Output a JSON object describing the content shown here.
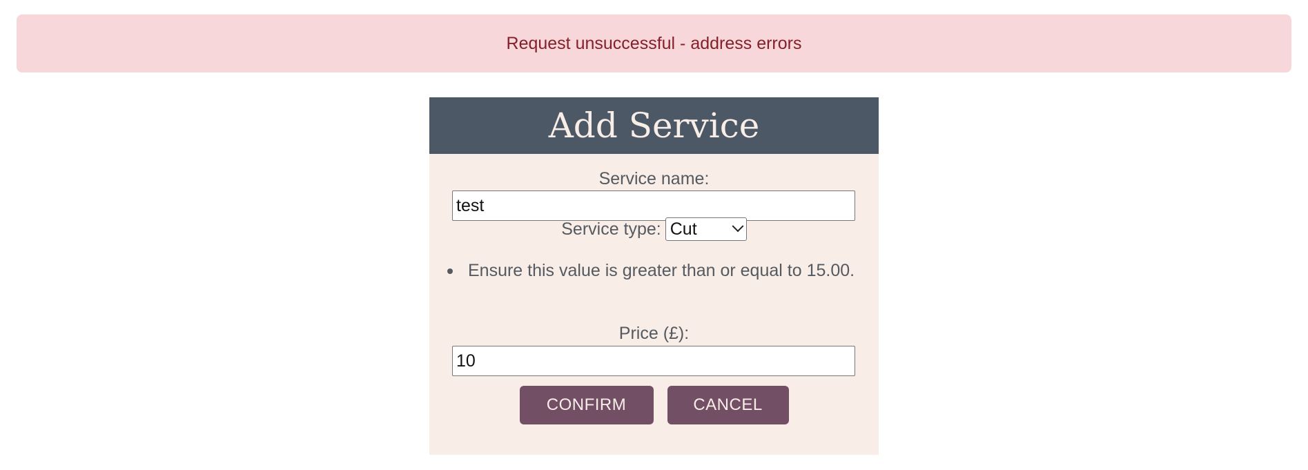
{
  "alert": {
    "message": "Request unsuccessful - address errors"
  },
  "form": {
    "title": "Add Service",
    "service_name_label": "Service name:",
    "service_name_value": "test",
    "service_type_label": "Service type:",
    "service_type_selected": "Cut",
    "errors": [
      "Ensure this value is greater than or equal to 15.00."
    ],
    "price_label": "Price (£):",
    "price_value": "10",
    "confirm_label": "CONFIRM",
    "cancel_label": "CANCEL"
  },
  "colors": {
    "alert_bg": "#f8d7da",
    "alert_text": "#842029",
    "header_bg": "#4c5865",
    "card_bg": "#f8ede7",
    "button_bg": "#734f66"
  },
  "icons": {
    "select_arrow": "chevron-down-icon"
  }
}
